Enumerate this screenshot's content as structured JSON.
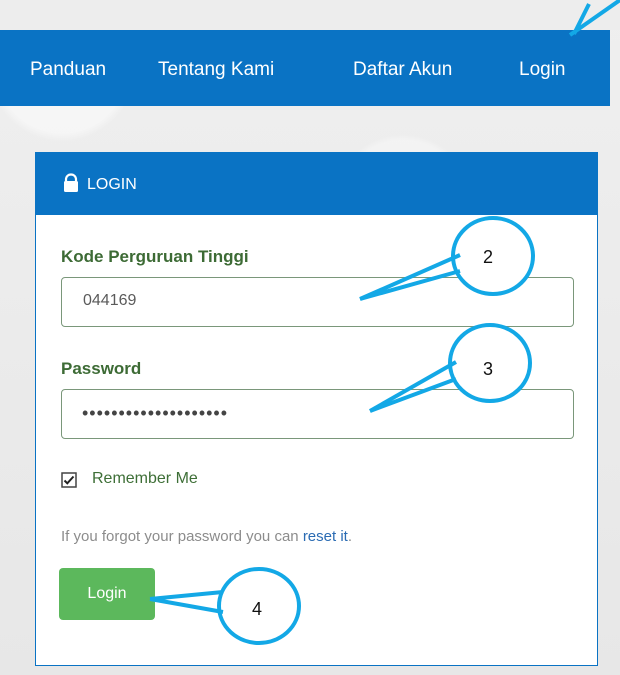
{
  "nav": {
    "items": [
      {
        "label": "Panduan"
      },
      {
        "label": "Tentang Kami"
      },
      {
        "label": "Daftar Akun"
      },
      {
        "label": "Login"
      }
    ]
  },
  "login_panel": {
    "title": "LOGIN",
    "fields": {
      "kode_label": "Kode Perguruan Tinggi",
      "kode_value": "044169",
      "password_label": "Password",
      "password_value": "••••••••••••••••••••"
    },
    "remember_label": "Remember Me",
    "help_prefix": "If you forgot your password you can",
    "help_link": "reset it",
    "help_suffix": ".",
    "button_label": "Login"
  },
  "callouts": {
    "two": "2",
    "three": "3",
    "four": "4"
  },
  "icons": {
    "lock": "lock-icon",
    "checkbox": "checkbox-icon"
  },
  "colors": {
    "primary": "#0a73c4",
    "success": "#5cb85c",
    "label_green": "#3d6b35",
    "callout_cyan": "#13a8e6"
  }
}
